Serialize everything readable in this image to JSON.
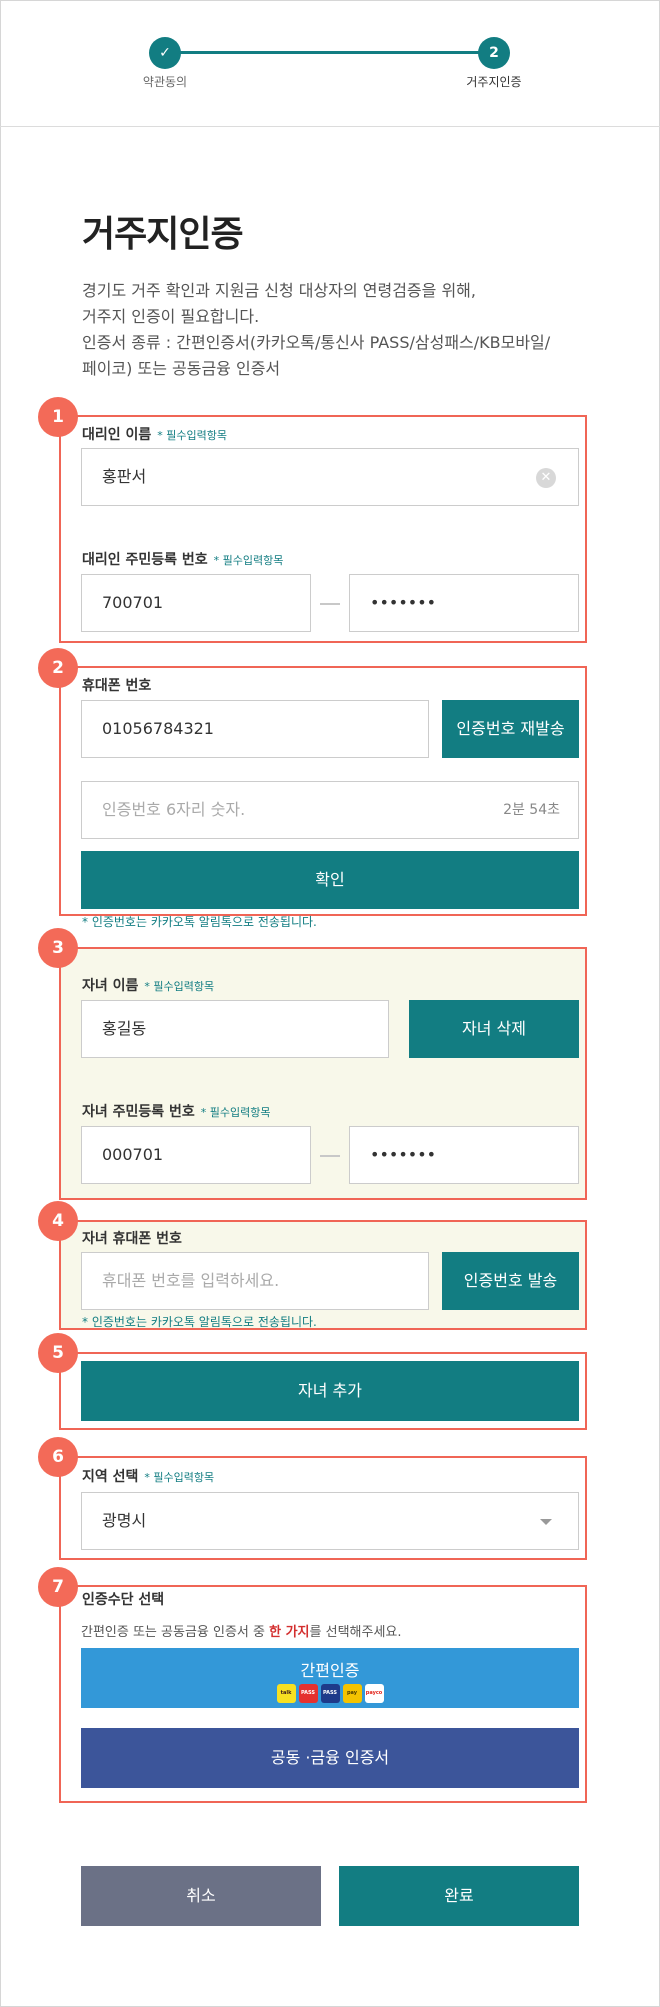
{
  "steps": [
    {
      "label": "약관동의",
      "state": "done",
      "icon": "check-icon"
    },
    {
      "label": "거주지인증",
      "state": "current",
      "number": "2"
    }
  ],
  "page": {
    "title": "거주지인증",
    "desc_lines": [
      "경기도 거주 확인과 지원금 신청 대상자의 연령검증을 위해,",
      "거주지 인증이 필요합니다.",
      "인증서 종류 : 간편인증서(카카오톡/통신사 PASS/삼성패스/KB모바일/",
      "페이코) 또는 공동금융 인증서"
    ]
  },
  "badges": [
    "1",
    "2",
    "3",
    "4",
    "5",
    "6",
    "7"
  ],
  "proxy": {
    "name_label": "대리인 이름",
    "required": "* 필수입력항목",
    "name_value": "홍판서",
    "rrn_label": "대리인 주민등록 번호",
    "rrn_front": "700701",
    "rrn_back": "•••••••"
  },
  "phone": {
    "label": "휴대폰 번호",
    "value": "01056784321",
    "resend": "인증번호 재발송",
    "code_placeholder": "인증번호 6자리 숫자.",
    "timer": "2분 54초",
    "confirm": "확인",
    "note": "* 인증번호는 카카오톡 알림톡으로 전송됩니다."
  },
  "child": {
    "name_label": "자녀 이름",
    "required": "* 필수입력항목",
    "name_value": "홍길동",
    "delete": "자녀 삭제",
    "rrn_label": "자녀 주민등록 번호",
    "rrn_front": "000701",
    "rrn_back": "•••••••",
    "phone_label": "자녀 휴대폰 번호",
    "phone_placeholder": "휴대폰 번호를 입력하세요.",
    "send": "인증번호 발송",
    "note": "* 인증번호는 카카오톡 알림톡으로 전송됩니다.",
    "add": "자녀 추가"
  },
  "region": {
    "label": "지역 선택",
    "required": "* 필수입력항목",
    "value": "광명시"
  },
  "auth": {
    "label": "인증수단 선택",
    "hint_before": "간편인증 또는 공동금융 인증서 중 ",
    "hint_highlight": "한 가지",
    "hint_after": "를 선택해주세요.",
    "simple": "간편인증",
    "logos": [
      "talk",
      "PASS",
      "PASS",
      "pay",
      "payco"
    ],
    "certificate": "공동 ·금융 인증서"
  },
  "actions": {
    "cancel": "취소",
    "done": "완료"
  },
  "colors": {
    "primary": "#127d82",
    "highlight": "#f06556",
    "cancel": "#6b7186",
    "simple": "#3398d8",
    "cert": "#3c559a"
  }
}
